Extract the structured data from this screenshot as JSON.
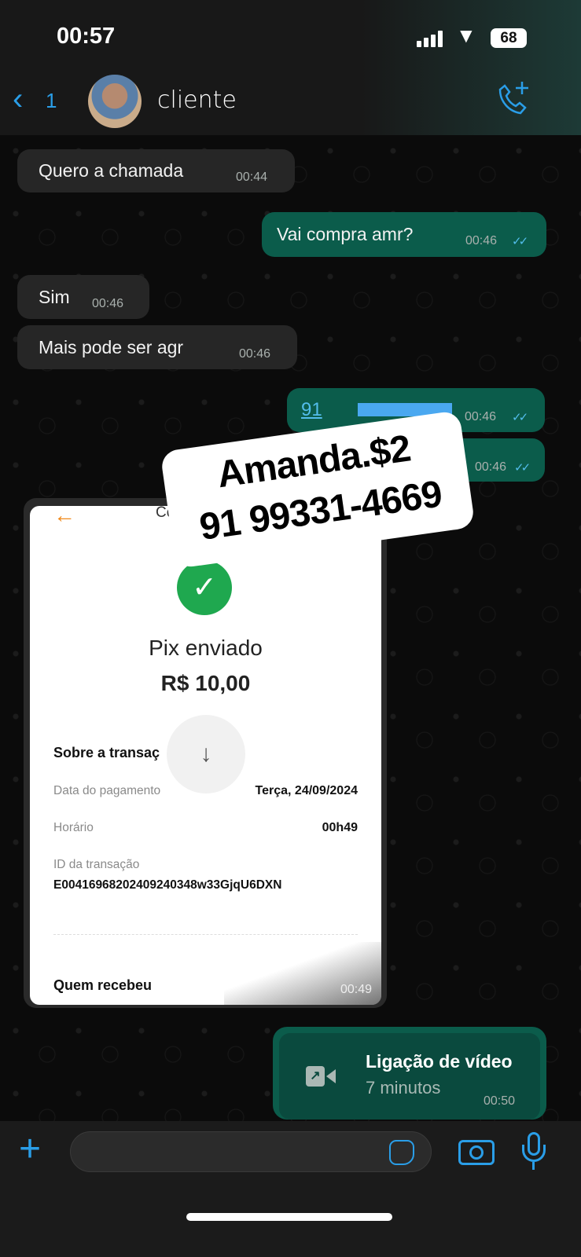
{
  "status_bar": {
    "time": "00:57",
    "battery": "68"
  },
  "header": {
    "back_count": "1",
    "contact_name": "cliente",
    "accent": "#2a9ee8"
  },
  "messages": [
    {
      "dir": "in",
      "text": "Quero a chamada",
      "time": "00:44"
    },
    {
      "dir": "out",
      "text": "Vai compra amr?",
      "time": "00:46"
    },
    {
      "dir": "in",
      "text": "Sim",
      "time": "00:46"
    },
    {
      "dir": "in",
      "text": "Mais pode ser agr",
      "time": "00:46"
    },
    {
      "dir": "out",
      "text": "91",
      "time": "00:46"
    },
    {
      "dir": "out",
      "text": "",
      "time": "00:46"
    }
  ],
  "sticker": {
    "line1": "Amanda.$2",
    "line2": "91 99331-4669"
  },
  "receipt": {
    "title_partial": "Co",
    "heading": "Pix enviado",
    "amount": "R$ 10,00",
    "section": "Sobre a transaç",
    "rows": [
      {
        "label": "Data do pagamento",
        "value": "Terça, 24/09/2024"
      },
      {
        "label": "Horário",
        "value": "00h49"
      }
    ],
    "id_label": "ID da transação",
    "id_value": "E00416968202409240348w33GjqU6DXN",
    "recipient_label": "Quem recebeu",
    "time": "00:49"
  },
  "video_call": {
    "title": "Ligação de vídeo",
    "duration": "7 minutos",
    "time": "00:50"
  },
  "composer": {
    "placeholder": ""
  }
}
